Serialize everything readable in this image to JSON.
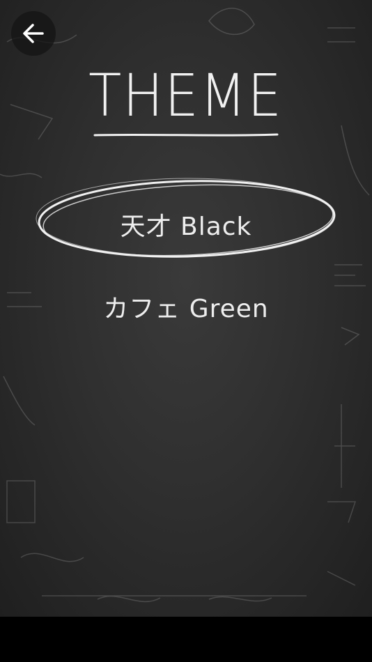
{
  "header": {
    "back_icon": "arrow-left-icon",
    "title": "THEME"
  },
  "themes": {
    "options": [
      {
        "label": "天才 Black",
        "selected": true
      },
      {
        "label": "カフェ Green",
        "selected": false
      }
    ]
  },
  "colors": {
    "chalkboard": "#2f2f2f",
    "chalk": "#f1f1f1",
    "back_button_bg": "#141414"
  }
}
